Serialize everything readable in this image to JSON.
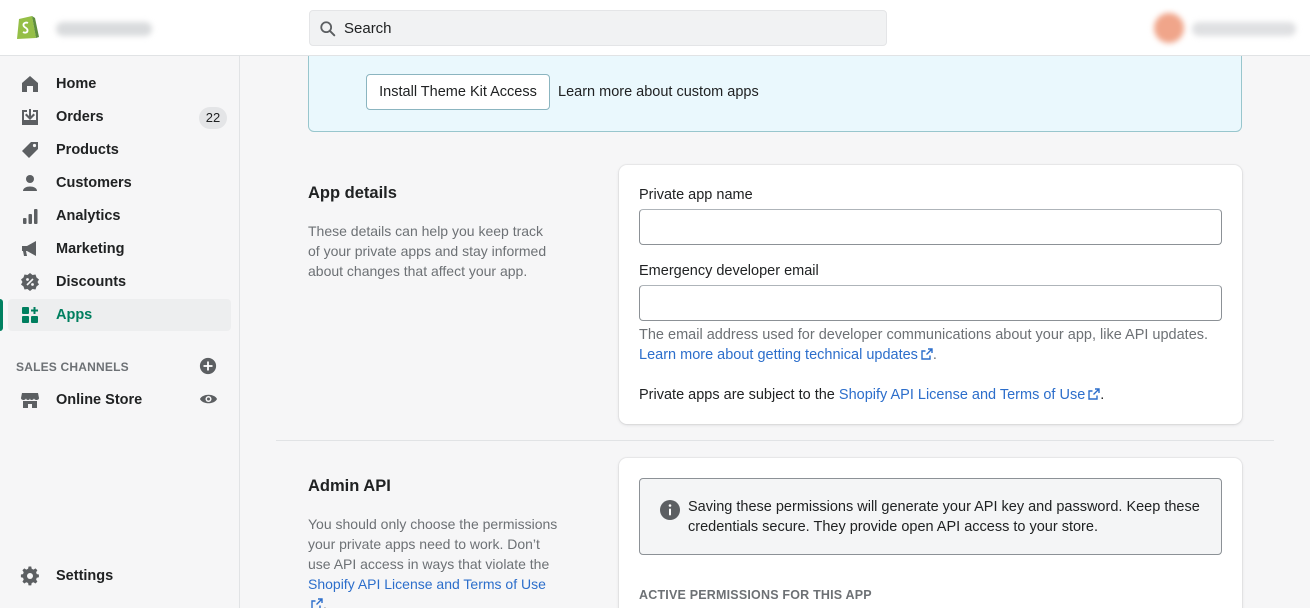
{
  "topbar": {
    "search_placeholder": "Search"
  },
  "sidebar": {
    "items": [
      {
        "label": "Home",
        "icon": "home-icon"
      },
      {
        "label": "Orders",
        "icon": "orders-icon",
        "badge": "22"
      },
      {
        "label": "Products",
        "icon": "tag-icon"
      },
      {
        "label": "Customers",
        "icon": "person-icon"
      },
      {
        "label": "Analytics",
        "icon": "bar-chart-icon"
      },
      {
        "label": "Marketing",
        "icon": "megaphone-icon"
      },
      {
        "label": "Discounts",
        "icon": "discount-icon"
      },
      {
        "label": "Apps",
        "icon": "apps-icon",
        "active": true
      }
    ],
    "sales_channels_title": "SALES CHANNELS",
    "online_store": "Online Store",
    "settings": "Settings"
  },
  "banner": {
    "button_label": "Install Theme Kit Access",
    "link_text": "Learn more about custom apps"
  },
  "app_details": {
    "heading": "App details",
    "description": "These details can help you keep track of your private apps and stay informed about changes that affect your app.",
    "name_label": "Private app name",
    "name_value": "",
    "email_label": "Emergency developer email",
    "email_value": "",
    "email_help": "The email address used for developer communications about your app, like API updates.",
    "email_help_link": "Learn more about getting technical updates",
    "terms_prefix": "Private apps are subject to the ",
    "terms_link": "Shopify API License and Terms of Use",
    "terms_suffix": "."
  },
  "admin_api": {
    "heading": "Admin API",
    "description_prefix": "You should only choose the permissions your private apps need to work. Don’t use API access in ways that violate the ",
    "description_link": "Shopify API License and Terms of Use",
    "description_suffix": ".",
    "notice": "Saving these permissions will generate your API key and password. Keep these credentials secure. They provide open API access to your store.",
    "permissions_title": "ACTIVE PERMISSIONS FOR THIS APP"
  },
  "colors": {
    "accent_green": "#008060",
    "link_blue": "#2c6ecb",
    "banner_bg": "#eaf8fd"
  }
}
